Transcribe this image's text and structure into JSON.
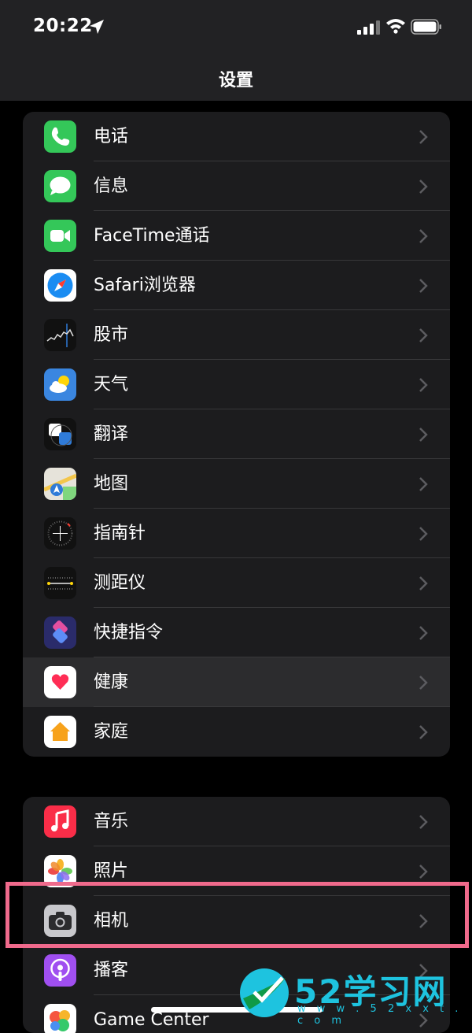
{
  "status_bar": {
    "time": "20:22"
  },
  "nav": {
    "title": "设置"
  },
  "section1": {
    "items": [
      {
        "label": "电话",
        "icon": "phone-icon"
      },
      {
        "label": "信息",
        "icon": "messages-icon"
      },
      {
        "label": "FaceTime通话",
        "icon": "facetime-icon"
      },
      {
        "label": "Safari浏览器",
        "icon": "safari-icon"
      },
      {
        "label": "股市",
        "icon": "stocks-icon"
      },
      {
        "label": "天气",
        "icon": "weather-icon"
      },
      {
        "label": "翻译",
        "icon": "translate-icon"
      },
      {
        "label": "地图",
        "icon": "maps-icon"
      },
      {
        "label": "指南针",
        "icon": "compass-icon"
      },
      {
        "label": "测距仪",
        "icon": "measure-icon"
      },
      {
        "label": "快捷指令",
        "icon": "shortcuts-icon"
      },
      {
        "label": "健康",
        "icon": "health-icon"
      },
      {
        "label": "家庭",
        "icon": "home-icon"
      }
    ]
  },
  "section2": {
    "items": [
      {
        "label": "音乐",
        "icon": "music-icon"
      },
      {
        "label": "照片",
        "icon": "photos-icon"
      },
      {
        "label": "相机",
        "icon": "camera-icon"
      },
      {
        "label": "播客",
        "icon": "podcasts-icon"
      },
      {
        "label": "Game Center",
        "icon": "game-center-icon"
      }
    ]
  },
  "watermark": {
    "text": "52学习网",
    "url": "w w w . 5 2 x x t . c o m"
  },
  "colors": {
    "background": "#000000",
    "card": "#1c1c1e",
    "highlight_border": "#f06a8c",
    "watermark": "#1ec3df"
  }
}
